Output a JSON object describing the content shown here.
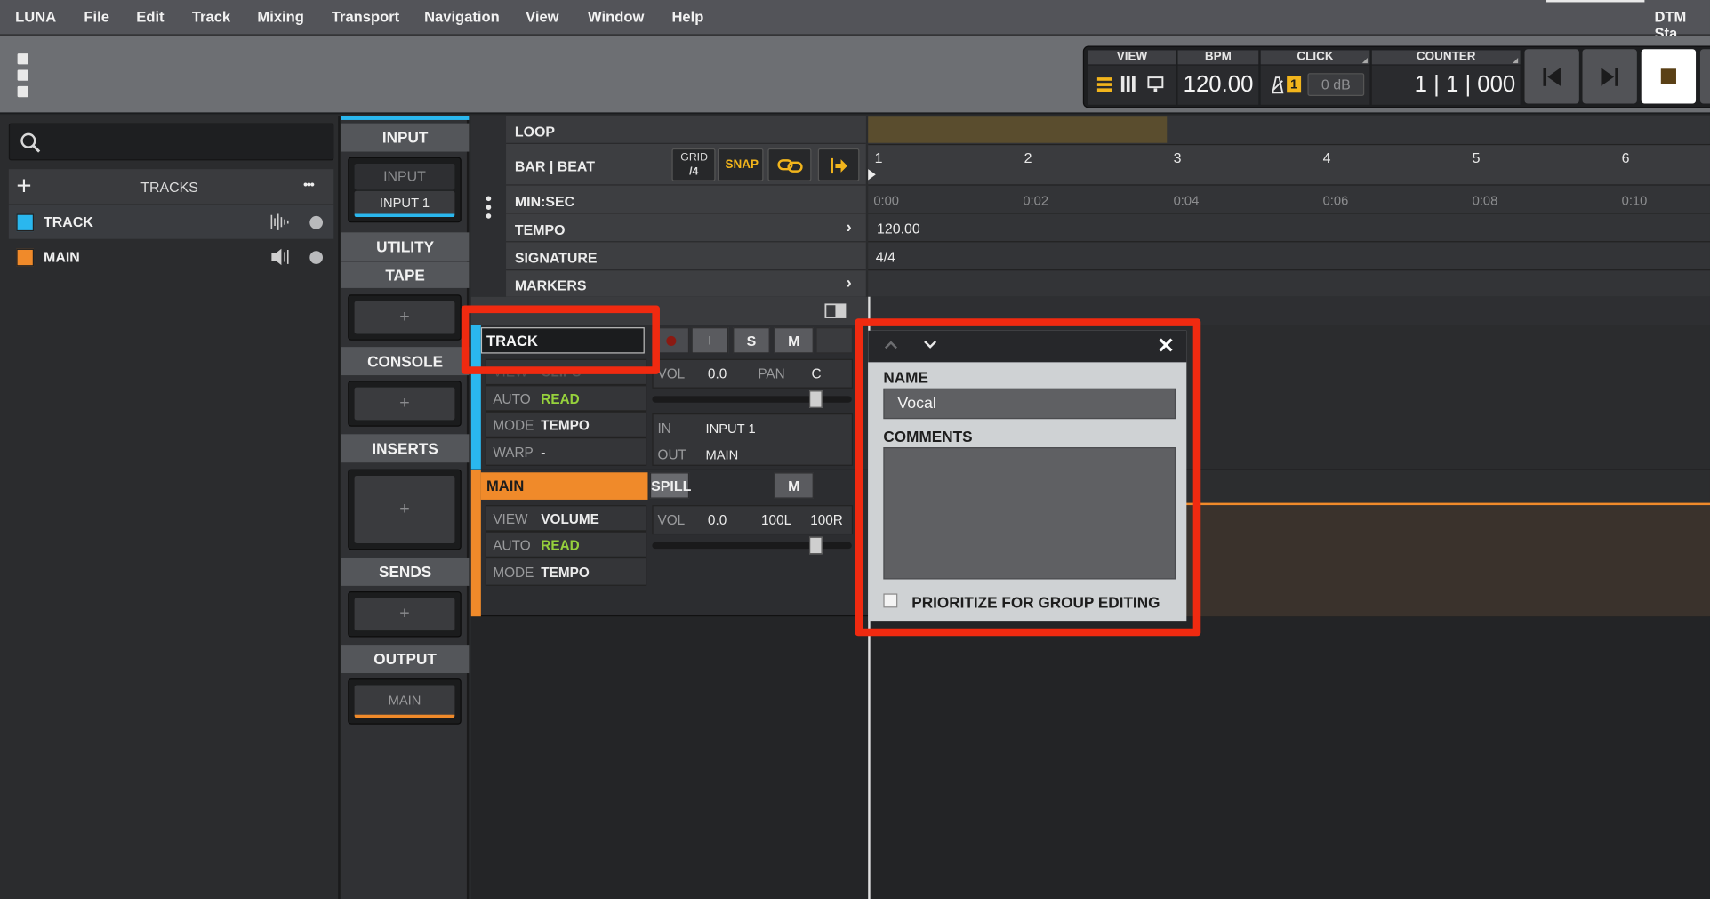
{
  "menu": {
    "app": "LUNA",
    "items": [
      "File",
      "Edit",
      "Track",
      "Mixing",
      "Transport",
      "Navigation",
      "View",
      "Window",
      "Help"
    ],
    "right_title": "DTM Sta"
  },
  "transport": {
    "view_label": "VIEW",
    "bpm_label": "BPM",
    "bpm_value": "120.00",
    "click_label": "CLICK",
    "click_count": "1",
    "click_level": "0 dB",
    "counter_label": "COUNTER",
    "counter_value": "1 | 1 | 000",
    "icons": [
      "list-view-icon",
      "mixer-view-icon",
      "screen-view-icon",
      "metronome-icon",
      "skip-back-icon",
      "skip-forward-icon",
      "stop-icon"
    ]
  },
  "left_panel": {
    "tracks_label": "TRACKS",
    "add_symbol": "+",
    "more_symbol": "•••",
    "tracks": [
      {
        "name": "TRACK",
        "color": "#2ab7ee"
      },
      {
        "name": "MAIN",
        "color": "#f08a2a"
      }
    ]
  },
  "strip": {
    "input": "INPUT",
    "input_slot_top": "INPUT",
    "input_slot_bottom": "INPUT 1",
    "utility": "UTILITY",
    "tape": "TAPE",
    "console": "CONSOLE",
    "inserts": "INSERTS",
    "sends": "SENDS",
    "output": "OUTPUT",
    "output_slot": "MAIN",
    "plus": "+"
  },
  "rulers": {
    "loop": "LOOP",
    "bar_beat": "BAR | BEAT",
    "grid": "GRID",
    "grid_value": "/4",
    "snap": "SNAP",
    "min_sec": "MIN:SEC",
    "tempo": "TEMPO",
    "signature": "SIGNATURE",
    "markers": "MARKERS",
    "bars": [
      "1",
      "2",
      "3",
      "4",
      "5",
      "6"
    ],
    "seconds": [
      "0:00",
      "0:02",
      "0:04",
      "0:06",
      "0:08",
      "0:10"
    ],
    "tempo_value": "120.00",
    "signature_value": "4/4"
  },
  "track1": {
    "name": "TRACK",
    "i": "I",
    "s": "S",
    "m": "M",
    "view_label": "VIEW",
    "view_value": "CLIPS",
    "auto_label": "AUTO",
    "auto_value": "READ",
    "mode_label": "MODE",
    "mode_value": "TEMPO",
    "warp_label": "WARP",
    "warp_value": "-",
    "vol_label": "VOL",
    "vol_value": "0.0",
    "pan_label": "PAN",
    "pan_value": "C",
    "in_label": "IN",
    "in_value": "INPUT 1",
    "out_label": "OUT",
    "out_value": "MAIN",
    "fader_level": 0.82
  },
  "track2": {
    "name": "MAIN",
    "spill": "SPILL",
    "m": "M",
    "view_label": "VIEW",
    "view_value": "VOLUME",
    "auto_label": "AUTO",
    "auto_value": "READ",
    "mode_label": "MODE",
    "mode_value": "TEMPO",
    "vol_label": "VOL",
    "vol_value": "0.0",
    "pan_l": "100L",
    "pan_r": "100R",
    "fader_level": 0.82
  },
  "popup": {
    "name_label": "NAME",
    "name_value": "Vocal",
    "comments_label": "COMMENTS",
    "comments_value": "",
    "prioritize_label": "PRIORITIZE FOR GROUP EDITING",
    "close_symbol": "✕"
  }
}
